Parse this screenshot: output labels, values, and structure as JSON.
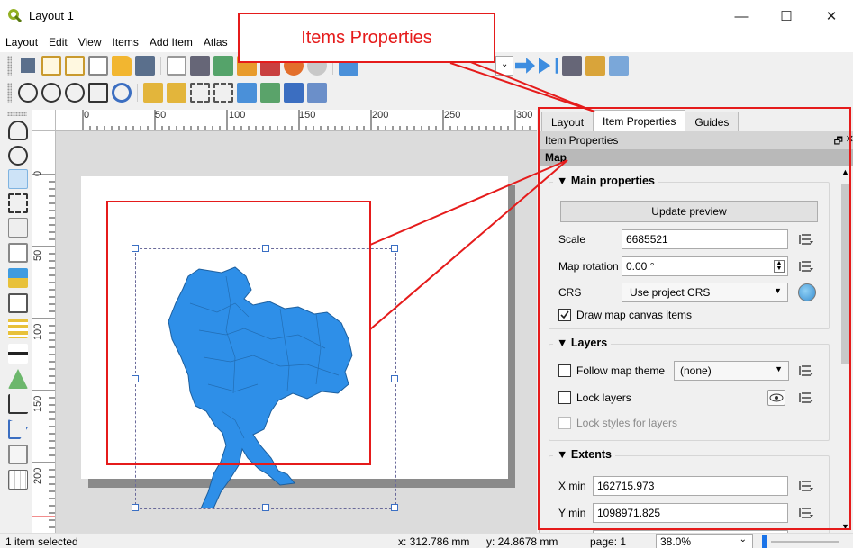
{
  "window": {
    "title": "Layout 1",
    "minimize": "—",
    "maximize": "☐",
    "close": "✕"
  },
  "menubar": {
    "items": [
      "Layout",
      "Edit",
      "View",
      "Items",
      "Add Item",
      "Atlas"
    ]
  },
  "annotation": {
    "callout_text": "Items Properties",
    "accent_color": "#e51b1b"
  },
  "ruler": {
    "h_ticks": [
      "0",
      "50",
      "100",
      "150",
      "200",
      "250",
      "300"
    ],
    "v_ticks": [
      "0",
      "50",
      "100",
      "150",
      "200"
    ]
  },
  "canvas": {
    "map_fill_color": "#2e8fe8"
  },
  "panel": {
    "tabs": [
      "Layout",
      "Item Properties",
      "Guides"
    ],
    "active_tab": "Item Properties",
    "dock_title": "Item Properties",
    "float_icon": "🗗",
    "close_icon": "✕",
    "item_header": "Map",
    "main": {
      "title": "Main properties",
      "update_button": "Update preview",
      "scale_label": "Scale",
      "scale_value": "6685521",
      "rotation_label": "Map rotation",
      "rotation_value": "0.00 °",
      "crs_label": "CRS",
      "crs_value": "Use project CRS",
      "draw_items_label": "Draw map canvas items",
      "draw_items_checked": true
    },
    "layers": {
      "title": "Layers",
      "follow_theme_label": "Follow map theme",
      "follow_theme_value": "(none)",
      "lock_layers_label": "Lock layers",
      "lock_styles_label": "Lock styles for layers"
    },
    "extents": {
      "title": "Extents",
      "xmin_label": "X min",
      "xmin_value": "162715.973",
      "ymin_label": "Y min",
      "ymin_value": "1098971.825"
    }
  },
  "status": {
    "selection": "1 item selected",
    "x_coord": "x: 312.786 mm",
    "y_coord": "y: 24.8678 mm",
    "page": "page: 1",
    "zoom": "38.0%"
  }
}
